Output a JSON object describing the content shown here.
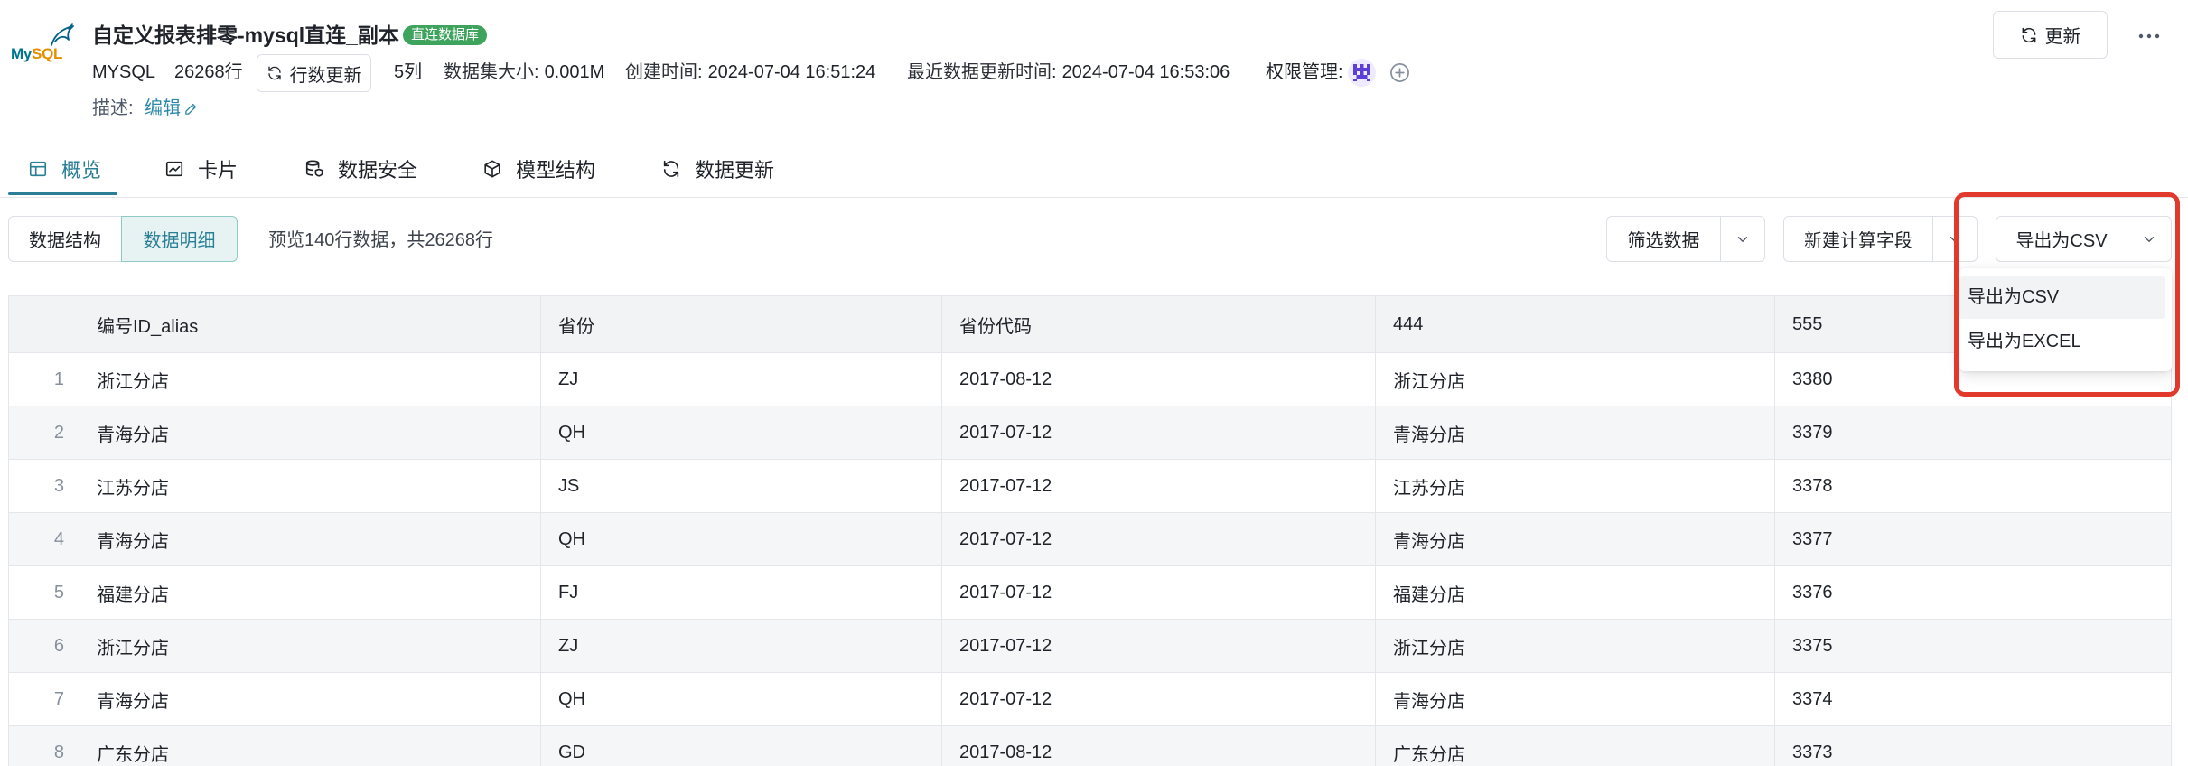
{
  "header": {
    "logo": {
      "part1": "My",
      "part2": "SQL",
      "icon": "mysql-dolphin-logo"
    },
    "title": "自定义报表排零-mysql直连_副本",
    "badge": "直连数据库",
    "update_button": {
      "label": "更新",
      "icon": "refresh-icon"
    },
    "more_icon": "more-horizontal-icon"
  },
  "meta": {
    "db_type": "MYSQL",
    "row_count": "26268行",
    "row_refresh_button": {
      "label": "行数更新",
      "icon": "refresh-icon"
    },
    "col_count": "5列",
    "dataset_size": {
      "label": "数据集大小:",
      "value": "0.001M"
    },
    "created": {
      "label": "创建时间:",
      "value": "2024-07-04 16:51:24"
    },
    "updated": {
      "label": "最近数据更新时间:",
      "value": "2024-07-04 16:53:06"
    },
    "permission": {
      "label": "权限管理:",
      "avatar_icon": "user-avatar-icon",
      "add_icon": "add-circle-icon"
    },
    "description": {
      "label": "描述:",
      "edit_link": "编辑",
      "edit_icon": "pencil-icon"
    }
  },
  "tabs": [
    {
      "label": "概览",
      "icon": "table-icon",
      "active": true
    },
    {
      "label": "卡片",
      "icon": "line-chart-icon",
      "active": false
    },
    {
      "label": "数据安全",
      "icon": "database-security-icon",
      "active": false
    },
    {
      "label": "模型结构",
      "icon": "cube-icon",
      "active": false
    },
    {
      "label": "数据更新",
      "icon": "refresh-icon",
      "active": false
    }
  ],
  "toolbar": {
    "view_toggle": [
      {
        "label": "数据结构",
        "active": false
      },
      {
        "label": "数据明细",
        "active": true
      }
    ],
    "preview_text": "预览140行数据，共26268行",
    "filter_button": {
      "label": "筛选数据",
      "icon": "chevron-down-icon"
    },
    "calc_field_button": {
      "label": "新建计算字段",
      "icon": "chevron-down-icon"
    },
    "export_button": {
      "label": "导出为CSV",
      "icon": "chevron-down-icon"
    }
  },
  "export_menu": {
    "open": true,
    "items": [
      {
        "label": "导出为CSV",
        "hovered": true
      },
      {
        "label": "导出为EXCEL",
        "hovered": false
      }
    ]
  },
  "table": {
    "columns": [
      "编号ID_alias",
      "省份",
      "省份代码",
      "444",
      "555"
    ],
    "rows": [
      {
        "index": "1",
        "cells": [
          "浙江分店",
          "ZJ",
          "2017-08-12",
          "浙江分店",
          "3380"
        ]
      },
      {
        "index": "2",
        "cells": [
          "青海分店",
          "QH",
          "2017-07-12",
          "青海分店",
          "3379"
        ]
      },
      {
        "index": "3",
        "cells": [
          "江苏分店",
          "JS",
          "2017-07-12",
          "江苏分店",
          "3378"
        ]
      },
      {
        "index": "4",
        "cells": [
          "青海分店",
          "QH",
          "2017-07-12",
          "青海分店",
          "3377"
        ]
      },
      {
        "index": "5",
        "cells": [
          "福建分店",
          "FJ",
          "2017-07-12",
          "福建分店",
          "3376"
        ]
      },
      {
        "index": "6",
        "cells": [
          "浙江分店",
          "ZJ",
          "2017-07-12",
          "浙江分店",
          "3375"
        ]
      },
      {
        "index": "7",
        "cells": [
          "青海分店",
          "QH",
          "2017-07-12",
          "青海分店",
          "3374"
        ]
      },
      {
        "index": "8",
        "cells": [
          "广东分店",
          "GD",
          "2017-08-12",
          "广东分店",
          "3373"
        ]
      }
    ]
  },
  "colors": {
    "accent": "#2a7f96",
    "link": "#2a88a8",
    "badge_bg": "#3da35d",
    "highlight_border": "#e2392d",
    "text": "#1f2329",
    "border": "#dcdfe6",
    "table_header_bg": "#f2f3f5",
    "row_stripe": "#f5f6f8"
  }
}
